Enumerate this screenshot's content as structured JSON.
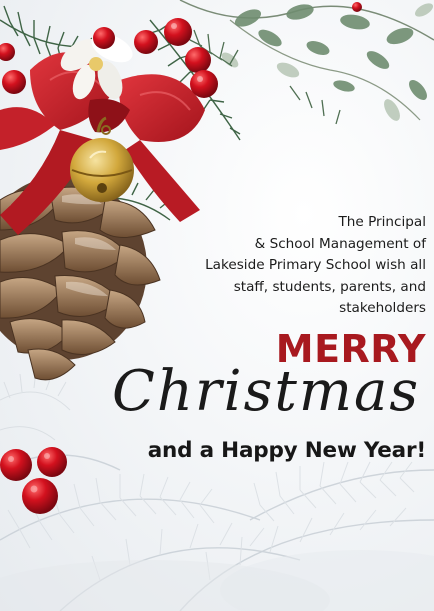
{
  "card": {
    "greeting_lines": [
      "The Principal",
      "& School Management of",
      "Lakeside Primary School wish all",
      "staff, students, parents, and",
      "stakeholders"
    ],
    "headline": "MERRY",
    "script_word": "Christmas",
    "subline": "and a Happy New Year!"
  },
  "colors": {
    "headline": "#a8191f",
    "text": "#1c1c1c",
    "ribbon": "#c4212a",
    "berry": "#c8101c",
    "bell": "#c9a030",
    "pinecone": "#8a6a4c",
    "pine": "#4f6f52",
    "background": "#f3f5f7"
  },
  "decor": {
    "top_left": "pine-cone-with-red-bow-and-bell",
    "top_right": "eucalyptus-and-pine-branches",
    "bottom_left": "red-berries",
    "bottom": "frosted-pine-branches"
  }
}
